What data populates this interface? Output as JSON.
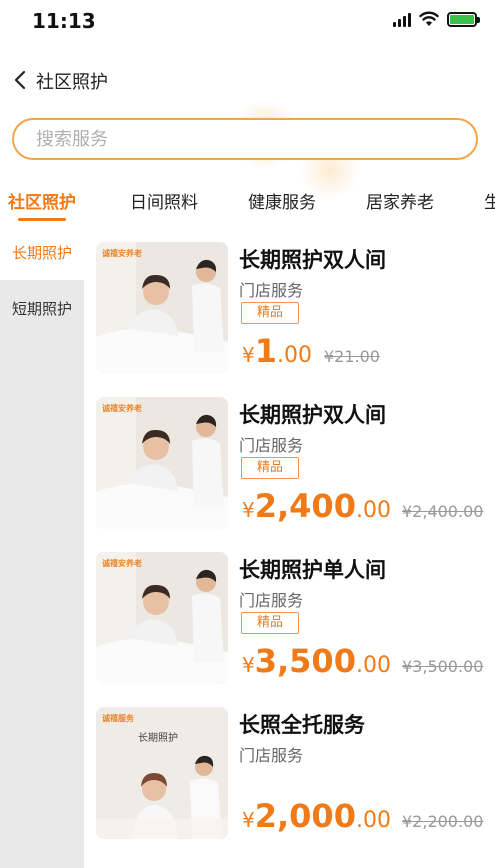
{
  "status_bar": {
    "time": "11:13"
  },
  "nav": {
    "title": "社区照护"
  },
  "search": {
    "placeholder": "搜索服务"
  },
  "category_tabs": [
    {
      "label": "社区照护",
      "active": true
    },
    {
      "label": "日间照料",
      "active": false
    },
    {
      "label": "健康服务",
      "active": false
    },
    {
      "label": "居家养老",
      "active": false
    },
    {
      "label": "生",
      "active": false
    }
  ],
  "sidebar": {
    "items": [
      {
        "label": "长期照护",
        "active": true
      },
      {
        "label": "短期照护",
        "active": false
      }
    ]
  },
  "products": [
    {
      "title": "长期照护双人间",
      "subtitle": "门店服务",
      "badge": "精品",
      "currency": "¥",
      "price_int": "1",
      "price_dec": ".00",
      "original_price": "¥21.00",
      "thumb_brand": "诚禧安养老"
    },
    {
      "title": "长期照护双人间",
      "subtitle": "门店服务",
      "badge": "精品",
      "currency": "¥",
      "price_int": "2,400",
      "price_dec": ".00",
      "original_price": "¥2,400.00",
      "thumb_brand": "诚禧安养老"
    },
    {
      "title": "长期照护单人间",
      "subtitle": "门店服务",
      "badge": "精品",
      "currency": "¥",
      "price_int": "3,500",
      "price_dec": ".00",
      "original_price": "¥3,500.00",
      "thumb_brand": "诚禧安养老"
    },
    {
      "title": "长照全托服务",
      "subtitle": "门店服务",
      "badge": "",
      "currency": "¥",
      "price_int": "2,000",
      "price_dec": ".00",
      "original_price": "¥2,200.00",
      "thumb_brand": "诚禧服务",
      "thumb_text": "长期照护"
    }
  ],
  "colors": {
    "accent": "#f07a18",
    "badge_border": "#f0955a",
    "search_border": "#f5a34a",
    "sidebar_bg": "#e9e9e9"
  }
}
